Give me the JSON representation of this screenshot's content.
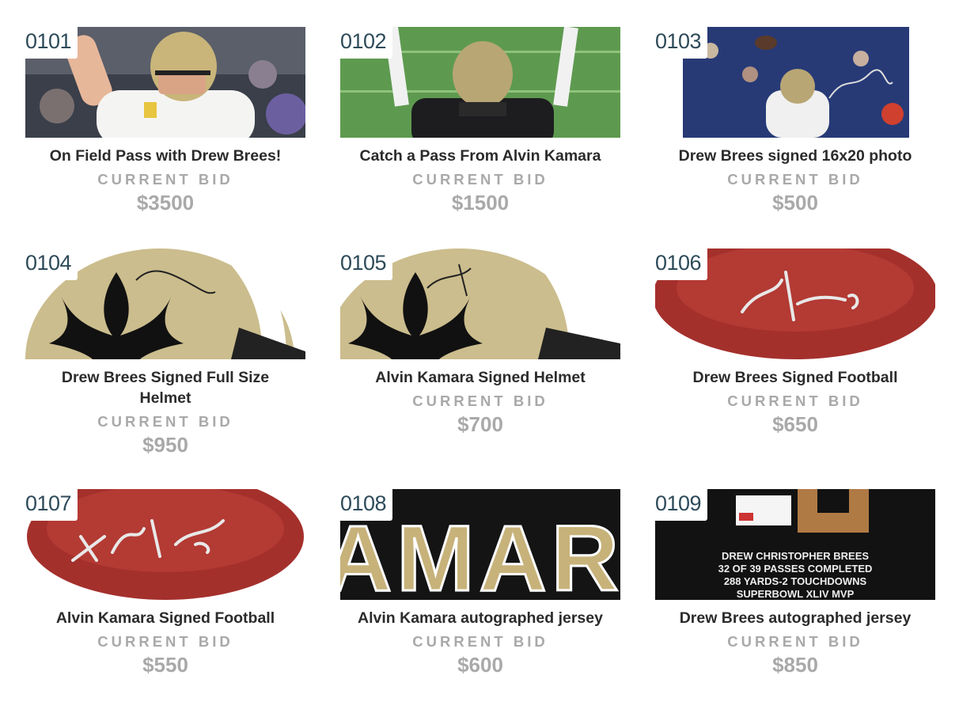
{
  "bid_label": "CURRENT BID",
  "colors": {
    "lot_text": "#2e4b5a",
    "title": "#2b2b2b",
    "bid": "#a9a9a9"
  },
  "items": [
    {
      "lot": "0101",
      "title": "On Field Pass with Drew Brees!",
      "bid": "$3500",
      "image": "drew-brees-celebrating-photo"
    },
    {
      "lot": "0102",
      "title": "Catch a Pass From Alvin Kamara",
      "bid": "$1500",
      "image": "alvin-kamara-arms-raised-photo"
    },
    {
      "lot": "0103",
      "title": "Drew Brees signed 16x20 photo",
      "bid": "$500",
      "image": "drew-brees-throwing-signed-photo"
    },
    {
      "lot": "0104",
      "title": "Drew Brees Signed Full Size Helmet",
      "bid": "$950",
      "image": "signed-saints-helmet-photo"
    },
    {
      "lot": "0105",
      "title": "Alvin Kamara Signed Helmet",
      "bid": "$700",
      "image": "signed-saints-helmet-photo"
    },
    {
      "lot": "0106",
      "title": "Drew Brees Signed Football",
      "bid": "$650",
      "image": "signed-football-photo"
    },
    {
      "lot": "0107",
      "title": "Alvin Kamara Signed Football",
      "bid": "$550",
      "image": "signed-football-photo"
    },
    {
      "lot": "0108",
      "title": "Alvin Kamara autographed jersey",
      "bid": "$600",
      "image": "kamara-jersey-lettering-photo"
    },
    {
      "lot": "0109",
      "title": "Drew Brees autographed jersey",
      "bid": "$850",
      "image": "brees-jersey-inscription-photo"
    }
  ],
  "jersey_text": "AMARA",
  "inscription": [
    "DREW CHRISTOPHER BREES",
    "32 OF 39 PASSES COMPLETED",
    "288 YARDS-2 TOUCHDOWNS",
    "SUPERBOWL XLIV MVP"
  ]
}
